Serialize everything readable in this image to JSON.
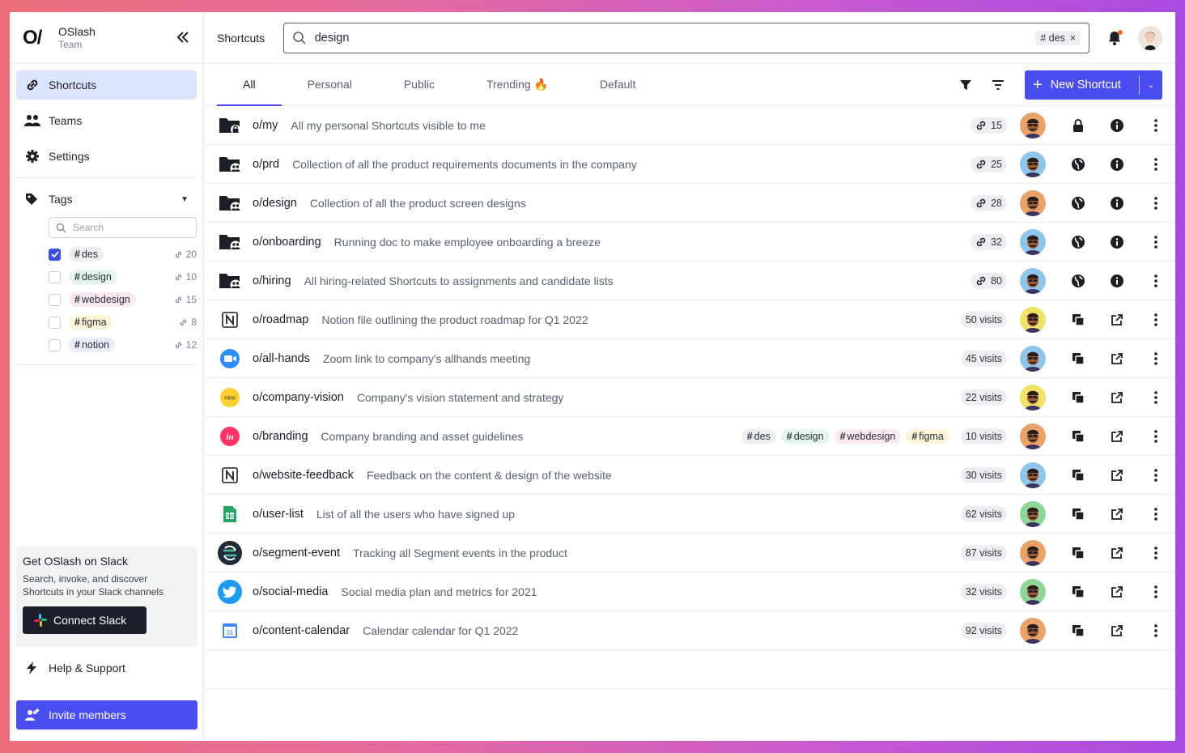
{
  "brand": {
    "logo": "O/",
    "name": "OSlash",
    "subtitle": "Team"
  },
  "sidebar": {
    "nav": [
      {
        "label": "Shortcuts",
        "icon": "link-icon",
        "active": true
      },
      {
        "label": "Teams",
        "icon": "people-icon",
        "active": false
      },
      {
        "label": "Settings",
        "icon": "gear-icon",
        "active": false
      }
    ],
    "tags_label": "Tags",
    "tag_search_placeholder": "Search",
    "tags": [
      {
        "hash": "#",
        "name": "des",
        "count": "20",
        "checked": true,
        "color": "#eceef2"
      },
      {
        "hash": "#",
        "name": "design",
        "count": "10",
        "checked": false,
        "color": "#e6f6ec"
      },
      {
        "hash": "#",
        "name": "webdesign",
        "count": "15",
        "checked": false,
        "color": "#fbe9f1"
      },
      {
        "hash": "#",
        "name": "figma",
        "count": "8",
        "checked": false,
        "color": "#fdf6d8"
      },
      {
        "hash": "#",
        "name": "notion",
        "count": "12",
        "checked": false,
        "color": "#e7edf9"
      }
    ],
    "slack": {
      "title": "Get OSlash on Slack",
      "desc": "Search, invoke, and discover Shortcuts in your Slack channels",
      "button": "Connect Slack"
    },
    "help": "Help & Support",
    "invite": "Invite members"
  },
  "header": {
    "crumb": "Shortcuts",
    "search_value": "design",
    "search_chip_hash": "#",
    "search_chip": "des",
    "search_chip_close": "×"
  },
  "tabs": [
    {
      "label": "All",
      "active": true
    },
    {
      "label": "Personal",
      "active": false
    },
    {
      "label": "Public",
      "active": false
    },
    {
      "label": "Trending 🔥",
      "active": false
    },
    {
      "label": "Default",
      "active": false
    }
  ],
  "new_button": {
    "plus": "+",
    "label": "New Shortcut",
    "caret": "⌄"
  },
  "rows": [
    {
      "icon": "folder-lock",
      "shortcut": "o/my",
      "desc": "All my personal Shortcuts visible to me",
      "count": "15",
      "kind": "link",
      "avatar": "#e7a36a",
      "visibility": "lock",
      "action": "info"
    },
    {
      "icon": "folder-team",
      "shortcut": "o/prd",
      "desc": "Collection of all the product requirements documents in the company",
      "count": "25",
      "kind": "link",
      "avatar": "#8fc5e8",
      "visibility": "globe",
      "action": "info"
    },
    {
      "icon": "folder-team",
      "shortcut": "o/design",
      "desc": "Collection of all the product screen designs",
      "count": "28",
      "kind": "link",
      "avatar": "#e7a36a",
      "visibility": "globe",
      "action": "info"
    },
    {
      "icon": "folder-team",
      "shortcut": "o/onboarding",
      "desc": "Running doc to make employee onboarding a breeze",
      "count": "32",
      "kind": "link",
      "avatar": "#8fc5e8",
      "visibility": "globe",
      "action": "info"
    },
    {
      "icon": "folder-team",
      "shortcut": "o/hiring",
      "desc": "All hiring-related Shortcuts to assignments and candidate lists",
      "count": "80",
      "kind": "link",
      "avatar": "#8fc5e8",
      "visibility": "globe",
      "action": "info"
    },
    {
      "icon": "notion",
      "shortcut": "o/roadmap",
      "desc": "Notion file outlining the product roadmap for Q1 2022",
      "count": "50 visits",
      "kind": "visits",
      "avatar": "#f0e36a",
      "visibility": "copy",
      "action": "external"
    },
    {
      "icon": "zoom",
      "shortcut": "o/all-hands",
      "desc": "Zoom link to company's allhands meeting",
      "count": "45 visits",
      "kind": "visits",
      "avatar": "#8fc5e8",
      "visibility": "copy",
      "action": "external"
    },
    {
      "icon": "miro",
      "shortcut": "o/company-vision",
      "desc": "Company's vision statement and strategy",
      "count": "22 visits",
      "kind": "visits",
      "avatar": "#f0e36a",
      "visibility": "copy",
      "action": "external"
    },
    {
      "icon": "invision",
      "shortcut": "o/branding",
      "desc": "Company branding and asset guidelines",
      "count": "10 visits",
      "kind": "visits",
      "avatar": "#e7a36a",
      "visibility": "copy",
      "action": "external",
      "tags": [
        {
          "hash": "#",
          "name": "des",
          "color": "#eceef2"
        },
        {
          "hash": "#",
          "name": "design",
          "color": "#e6f6ec"
        },
        {
          "hash": "#",
          "name": "webdesign",
          "color": "#fbe9f1"
        },
        {
          "hash": "#",
          "name": "figma",
          "color": "#fdf6d8"
        }
      ]
    },
    {
      "icon": "notion",
      "shortcut": "o/website-feedback",
      "desc": "Feedback on the content & design of the website",
      "count": "30 visits",
      "kind": "visits",
      "avatar": "#8fc5e8",
      "visibility": "copy",
      "action": "external"
    },
    {
      "icon": "sheets",
      "shortcut": "o/user-list",
      "desc": "List of all the users who have signed up",
      "count": "62 visits",
      "kind": "visits",
      "avatar": "#8fd69a",
      "visibility": "copy",
      "action": "external"
    },
    {
      "icon": "segment",
      "shortcut": "o/segment-event",
      "desc": "Tracking all Segment events in the product",
      "count": "87 visits",
      "kind": "visits",
      "avatar": "#e7a36a",
      "visibility": "copy",
      "action": "external"
    },
    {
      "icon": "twitter",
      "shortcut": "o/social-media",
      "desc": "Social media plan and metrics for 2021",
      "count": "32 visits",
      "kind": "visits",
      "avatar": "#8fd69a",
      "visibility": "copy",
      "action": "external"
    },
    {
      "icon": "gcal",
      "shortcut": "o/content-calendar",
      "desc": "Calendar calendar for Q1 2022",
      "count": "92 visits",
      "kind": "visits",
      "avatar": "#e7a36a",
      "visibility": "copy",
      "action": "external"
    }
  ],
  "app_icons": {
    "miro": "miro",
    "invision": "in",
    "gcal": "31"
  },
  "colors": {
    "accent": "#4a4df0",
    "active_nav": "#dbe4fb"
  }
}
